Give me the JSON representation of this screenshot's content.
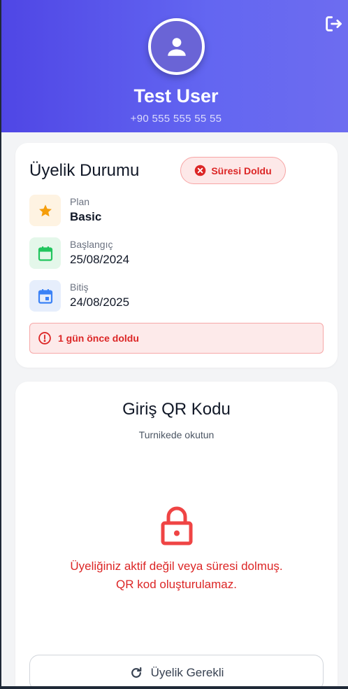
{
  "header": {
    "user_name": "Test User",
    "phone": "+90 555 555 55 55",
    "avatar_icon": "user-icon",
    "logout_icon": "logout-icon"
  },
  "membership": {
    "title": "Üyelik Durumu",
    "status_label": "Süresi Doldu",
    "plan_label": "Plan",
    "plan_value": "Basic",
    "start_label": "Başlangıç",
    "start_value": "25/08/2024",
    "end_label": "Bitiş",
    "end_value": "24/08/2025",
    "alert_text": "1 gün önce doldu"
  },
  "qr": {
    "title": "Giriş QR Kodu",
    "subtitle": "Turnikede okutun",
    "message_line1": "Üyeliğiniz aktif değil veya süresi dolmuş.",
    "message_line2": "QR kod oluşturulamaz.",
    "button_label": "Üyelik Gerekli"
  },
  "colors": {
    "header_gradient_start": "#4f46e5",
    "header_gradient_end": "#6d6cf0",
    "danger": "#dc2626",
    "plan_icon": "#f59e0b",
    "start_icon": "#22c55e",
    "end_icon": "#3b82f6"
  }
}
